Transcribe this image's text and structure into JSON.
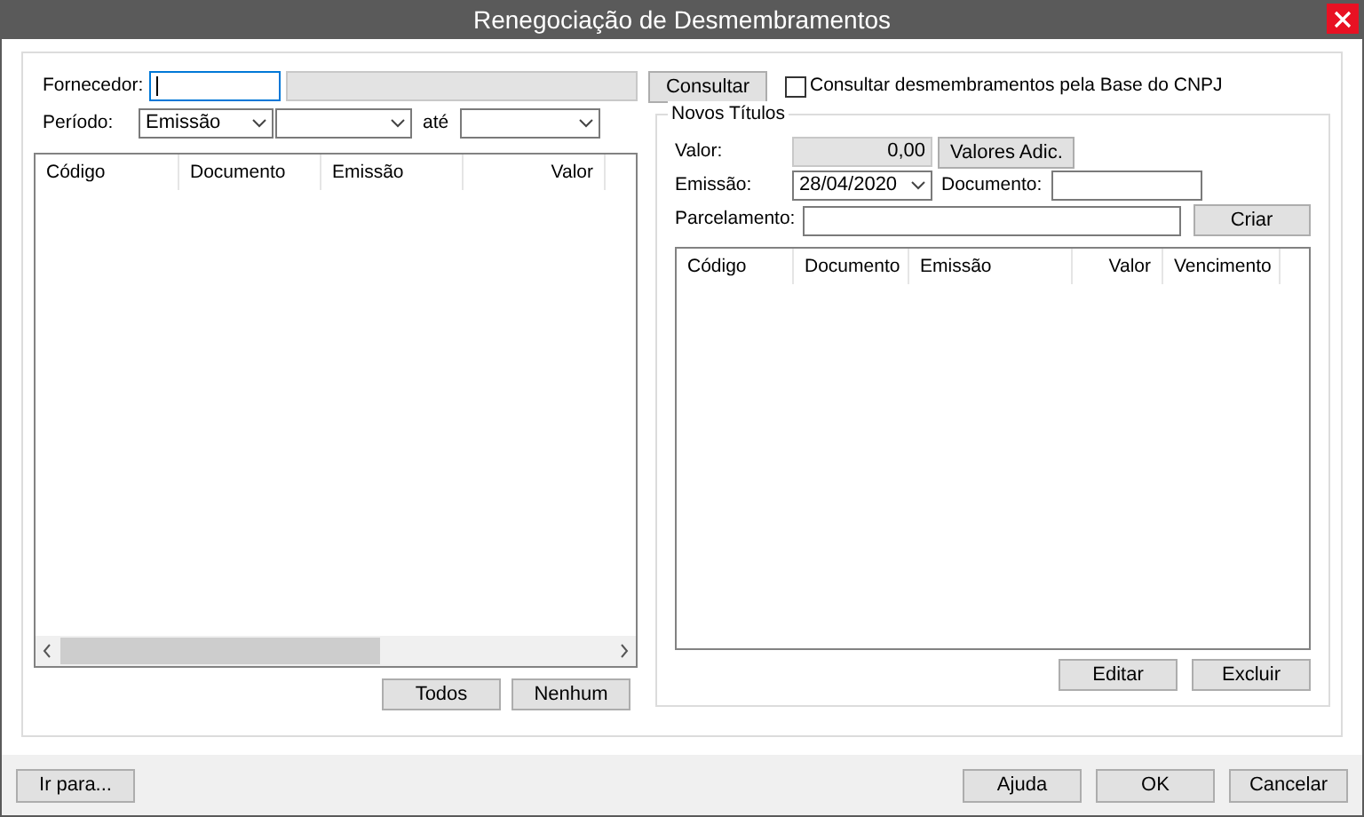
{
  "window": {
    "title": "Renegociação de Desmembramentos"
  },
  "supplier": {
    "label": "Fornecedor:"
  },
  "consult_button": "Consultar",
  "cnpj_checkbox": {
    "label": "Consultar desmembramentos pela Base do CNPJ",
    "checked": false
  },
  "period": {
    "label": "Período:",
    "type": "Emissão",
    "to_label": "até"
  },
  "left_table": {
    "columns": [
      {
        "label": "Código"
      },
      {
        "label": "Documento"
      },
      {
        "label": "Emissão"
      },
      {
        "label": "Valor"
      }
    ]
  },
  "left_buttons": [
    "Todos",
    "Nenhum"
  ],
  "new_titles": {
    "title": "Novos Títulos",
    "value_label": "Valor:",
    "value": "0,00",
    "extra_button": "Valores Adic.",
    "issue_label": "Emissão:",
    "issue": "28/04/2020",
    "document_label": "Documento:",
    "installments_label": "Parcelamento:",
    "create_button": "Criar",
    "columns": [
      {
        "label": "Código"
      },
      {
        "label": "Documento"
      },
      {
        "label": "Emissão"
      },
      {
        "label": "Valor"
      },
      {
        "label": "Vencimento"
      }
    ],
    "buttons": [
      "Editar",
      "Excluir"
    ]
  },
  "footer": {
    "left_button": "Ir para...",
    "buttons": [
      "Ajuda",
      "OK",
      "Cancelar"
    ]
  }
}
